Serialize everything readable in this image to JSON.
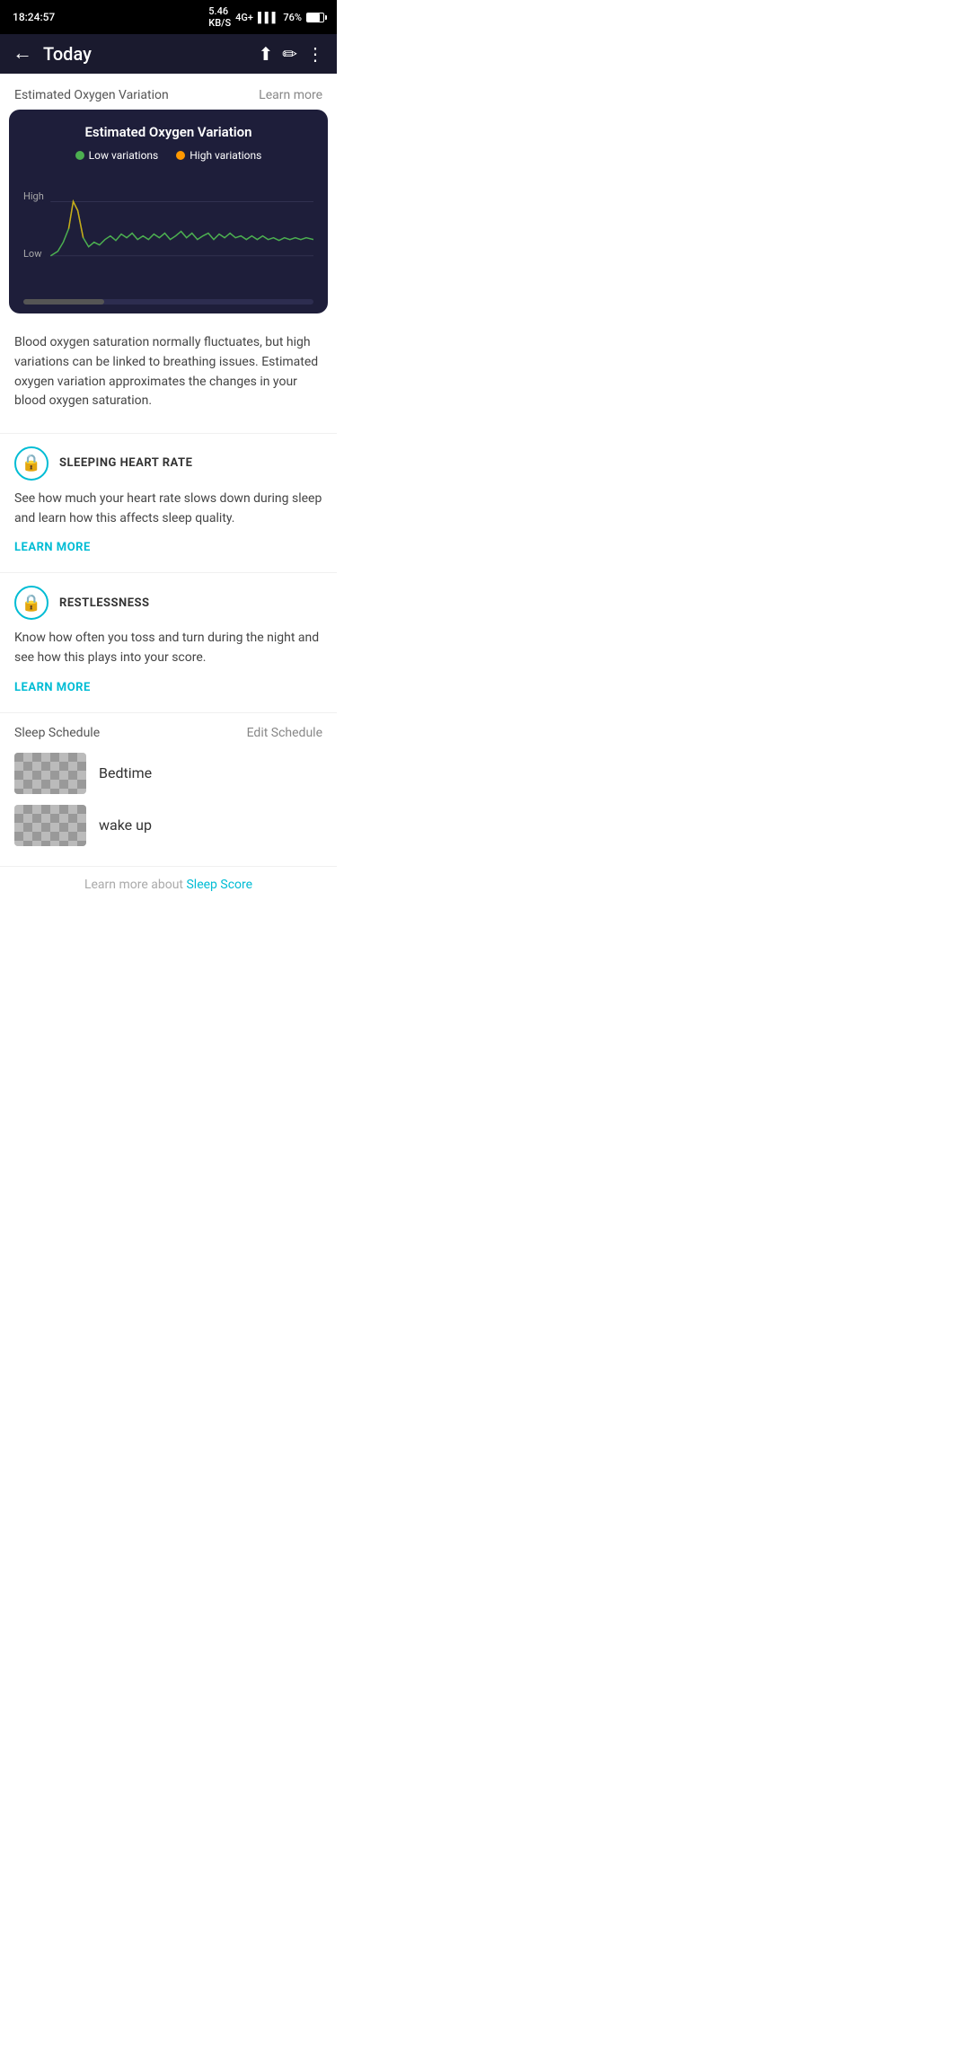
{
  "statusBar": {
    "time": "18:24:57",
    "speed": "5.46",
    "speedUnit": "KB/S",
    "network": "4G+",
    "battery": "76%"
  },
  "topBar": {
    "title": "Today",
    "backIcon": "←",
    "shareIcon": "⬆",
    "editIcon": "✏",
    "moreIcon": "⋮"
  },
  "oxygenSection": {
    "sectionTitle": "Estimated Oxygen Variation",
    "learnMore": "Learn more",
    "chartTitle": "Estimated Oxygen Variation",
    "legendLow": "Low variations",
    "legendHigh": "High variations",
    "chartLabelHigh": "High",
    "chartLabelLow": "Low",
    "description": "Blood oxygen saturation normally fluctuates, but high variations can be linked to breathing issues. Estimated oxygen variation approximates the changes in your blood oxygen saturation."
  },
  "sleepingHeartRate": {
    "label": "SLEEPING HEART RATE",
    "description": "See how much your heart rate slows down during sleep and learn how this affects sleep quality.",
    "learnMore": "LEARN MORE"
  },
  "restlessness": {
    "label": "RESTLESSNESS",
    "description": "Know how often you toss and turn during the night and see how this plays into your score.",
    "learnMore": "LEARN MORE"
  },
  "sleepSchedule": {
    "title": "Sleep Schedule",
    "editSchedule": "Edit Schedule",
    "bedtime": "Bedtime",
    "wakeup": "wake up"
  },
  "footer": {
    "text": "Learn more about",
    "linkText": "Sleep Score"
  }
}
